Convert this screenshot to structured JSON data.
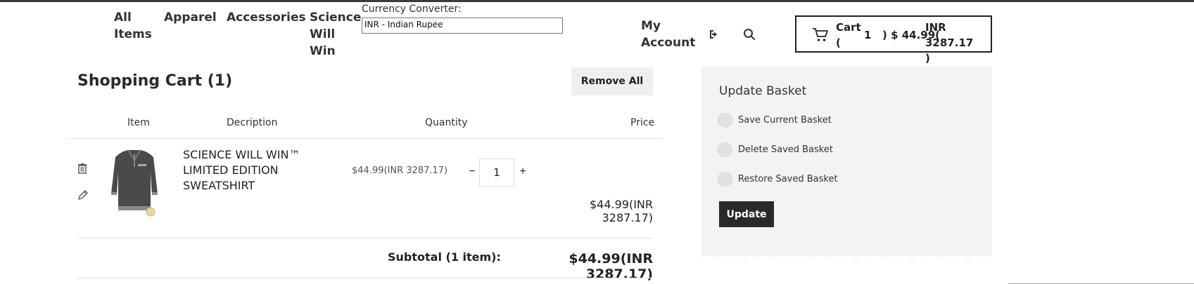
{
  "nav": {
    "all_items": "All Items",
    "apparel": "Apparel",
    "accessories": "Accessories",
    "science": "Science Will Win",
    "my_account": "My Account"
  },
  "currency": {
    "label": "Currency Converter:",
    "selected": "INR - Indian Rupee"
  },
  "header_icons": [
    "logout-icon",
    "search-icon",
    "cart-icon"
  ],
  "cart": {
    "label": "Cart (",
    "count": "1",
    "total": ") $ 44.99(",
    "inr": "INR 3287.17",
    "close": ")"
  },
  "page": {
    "title": "Shopping Cart (1)",
    "remove_all": "Remove All"
  },
  "table": {
    "headers": [
      "Item",
      "Decription",
      "Quantity",
      "Price"
    ],
    "rows": [
      {
        "name": "SCIENCE WILL WIN™ LIMITED EDITION SWEATSHIRT",
        "unit_price": "$44.99(INR 3287.17)",
        "quantity": "1",
        "minus": "−",
        "plus": "+",
        "line_price": "$44.99(INR 3287.17)"
      }
    ],
    "row_icons": [
      "trash-icon",
      "edit-icon"
    ]
  },
  "subtotal": {
    "label": "Subtotal (1 item):",
    "value": "$44.99(INR 3287.17)"
  },
  "basket": {
    "title": "Update Basket",
    "options": [
      "Save Current Basket",
      "Delete Saved Basket",
      "Restore Saved Basket"
    ],
    "update": "Update"
  },
  "colors": {
    "panel_bg": "#f3f3f3",
    "button_dark": "#2a2a2a",
    "remove_bg": "#efefef"
  }
}
